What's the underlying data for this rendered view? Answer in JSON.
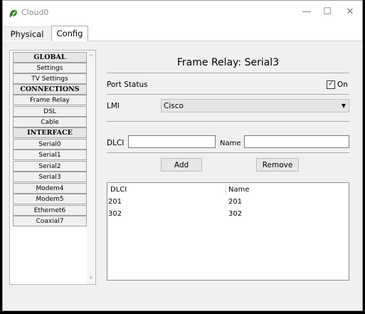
{
  "window": {
    "title": "Cloud0",
    "icon": "cloud-leaf-icon",
    "minimize": "—",
    "maximize": "☐",
    "close": "✕"
  },
  "tabs": [
    {
      "label": "Physical"
    },
    {
      "label": "Config"
    }
  ],
  "sidebar": {
    "items": [
      {
        "label": "GLOBAL",
        "header": true
      },
      {
        "label": "Settings"
      },
      {
        "label": "TV Settings"
      },
      {
        "label": "CONNECTIONS",
        "header": true
      },
      {
        "label": "Frame Relay"
      },
      {
        "label": "DSL"
      },
      {
        "label": "Cable"
      },
      {
        "label": "INTERFACE",
        "header": true
      },
      {
        "label": "Serial0"
      },
      {
        "label": "Serial1"
      },
      {
        "label": "Serial2"
      },
      {
        "label": "Serial3"
      },
      {
        "label": "Modem4"
      },
      {
        "label": "Modem5"
      },
      {
        "label": "Ethernet6"
      },
      {
        "label": "Coaxial7"
      }
    ],
    "scroll_up": "^",
    "scroll_down": "v"
  },
  "main": {
    "heading": "Frame Relay: Serial3",
    "port_status_label": "Port Status",
    "port_on_label": "On",
    "port_on_checked": true,
    "lmi_label": "LMI",
    "lmi_value": "Cisco",
    "lmi_arrow": "▼",
    "dlci_label": "DLCI",
    "dlci_value": "",
    "name_label": "Name",
    "name_value": "",
    "add_label": "Add",
    "remove_label": "Remove",
    "table": {
      "headers": [
        "DLCI",
        "Name"
      ],
      "rows": [
        [
          "201",
          "201"
        ],
        [
          "302",
          "302"
        ]
      ]
    }
  }
}
